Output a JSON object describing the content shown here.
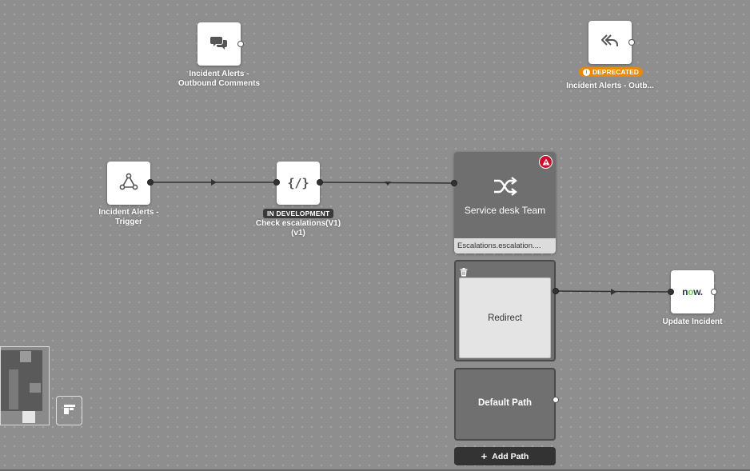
{
  "nodes": {
    "outbound_comments": {
      "label_line1": "Incident Alerts -",
      "label_line2": "Outbound Comments",
      "icon": "chat-bubbles-icon"
    },
    "outbound_deprecated": {
      "badge": "DEPRECATED",
      "label": "Incident Alerts - Outb...",
      "icon": "reply-all-icon"
    },
    "trigger": {
      "label_line1": "Incident Alerts -",
      "label_line2": "Trigger",
      "icon": "webhook-icon"
    },
    "check_escalations": {
      "badge": "IN DEVELOPMENT",
      "label_line1": "Check escalations(V1)",
      "label_line2": "(v1)",
      "icon": "code-icon",
      "icon_text": "{/}"
    },
    "update_incident": {
      "label": "Update Incident",
      "icon": "servicenow-logo",
      "logo_text": "now."
    }
  },
  "decision": {
    "title": "Service desk Team",
    "footer": "Escalations.escalation....",
    "icon": "shuffle-icon",
    "status_icon": "warning-icon"
  },
  "paths": {
    "redirect": {
      "label": "Redirect",
      "icon": "trash-icon"
    },
    "default": {
      "label": "Default Path"
    }
  },
  "add_path": {
    "label": "Add Path",
    "icon": "plus-icon",
    "icon_text": "+"
  },
  "colors": {
    "canvas": "#8e8e8e",
    "decision": "#6f6f6f",
    "deprecated": "#e8880c",
    "warning": "#c8102e",
    "servicenow_green": "#62d84e"
  }
}
